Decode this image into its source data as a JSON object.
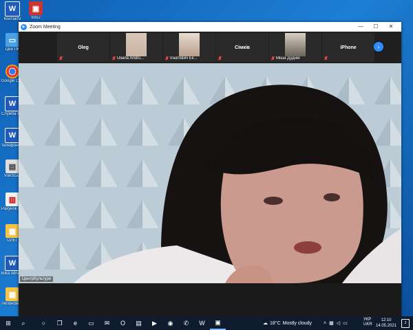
{
  "desktop": {
    "icons": [
      {
        "label": "Контакти",
        "type": "word",
        "glyph": "W"
      },
      {
        "label": "foto2",
        "type": "photo",
        "glyph": "▣"
      },
      {
        "label": "Цей ПК",
        "type": "pc",
        "glyph": "▭"
      },
      {
        "label": "Google Chrome",
        "type": "chrome",
        "glyph": ""
      },
      {
        "label": "Служба Божа за...",
        "type": "word",
        "glyph": "W"
      },
      {
        "label": "телефони 23.02.2018",
        "type": "word",
        "glyph": "W"
      },
      {
        "label": "VueScan",
        "type": "scan",
        "glyph": "▤"
      },
      {
        "label": "Рахунок комуналь...",
        "type": "pdf",
        "glyph": "▥"
      },
      {
        "label": "ОЛЕГ",
        "type": "folder",
        "glyph": "▦"
      },
      {
        "label": "kilka odnianu...",
        "type": "word",
        "glyph": "W"
      },
      {
        "label": "Легіонові 2021",
        "type": "folder",
        "glyph": "▦"
      }
    ]
  },
  "zoom": {
    "title": "Zoom Meeting",
    "controls": {
      "minimize": "—",
      "maximize": "☐",
      "close": "✕"
    },
    "participants": [
      {
        "name": "Oleg",
        "muted_label": "",
        "has_video": false
      },
      {
        "name": "",
        "muted_label": "Uliana Andru...",
        "has_video": true
      },
      {
        "name": "",
        "muted_label": "Ігнатович Ек...",
        "has_video": true
      },
      {
        "name": "Сімків",
        "muted_label": "",
        "has_video": false
      },
      {
        "name": "",
        "muted_label": "Міша Дудній",
        "has_video": true
      },
      {
        "name": "iPhone",
        "muted_label": "",
        "has_video": false
      }
    ],
    "next_page_icon": "›",
    "active_speaker_label": "ЦентрКультури"
  },
  "taskbar": {
    "start_icon": "⊞",
    "search_icon": "⌕",
    "apps": [
      {
        "name": "cortana-icon",
        "glyph": "○"
      },
      {
        "name": "task-view-icon",
        "glyph": "❐"
      },
      {
        "name": "edge-icon",
        "glyph": "e"
      },
      {
        "name": "explorer-icon",
        "glyph": "▭"
      },
      {
        "name": "mail-icon",
        "glyph": "✉"
      },
      {
        "name": "opera-icon",
        "glyph": "O"
      },
      {
        "name": "store-icon",
        "glyph": "▤"
      },
      {
        "name": "media-icon",
        "glyph": "▶"
      },
      {
        "name": "chrome-icon",
        "glyph": "◉"
      },
      {
        "name": "viber-icon",
        "glyph": "✆"
      },
      {
        "name": "word-icon",
        "glyph": "W"
      },
      {
        "name": "zoom-icon",
        "glyph": "▣",
        "active": true
      }
    ],
    "weather": {
      "temp": "18°C",
      "desc": "Mostly cloudy"
    },
    "language": {
      "line1": "УКР",
      "line2": "UKR"
    },
    "clock": {
      "time": "12:10",
      "date": "14.05.2021"
    },
    "notifications": "2"
  },
  "colors": {
    "zoom_blue": "#2d8cff",
    "muted_red": "#e8453c",
    "taskbar": "#0f1c2e"
  }
}
